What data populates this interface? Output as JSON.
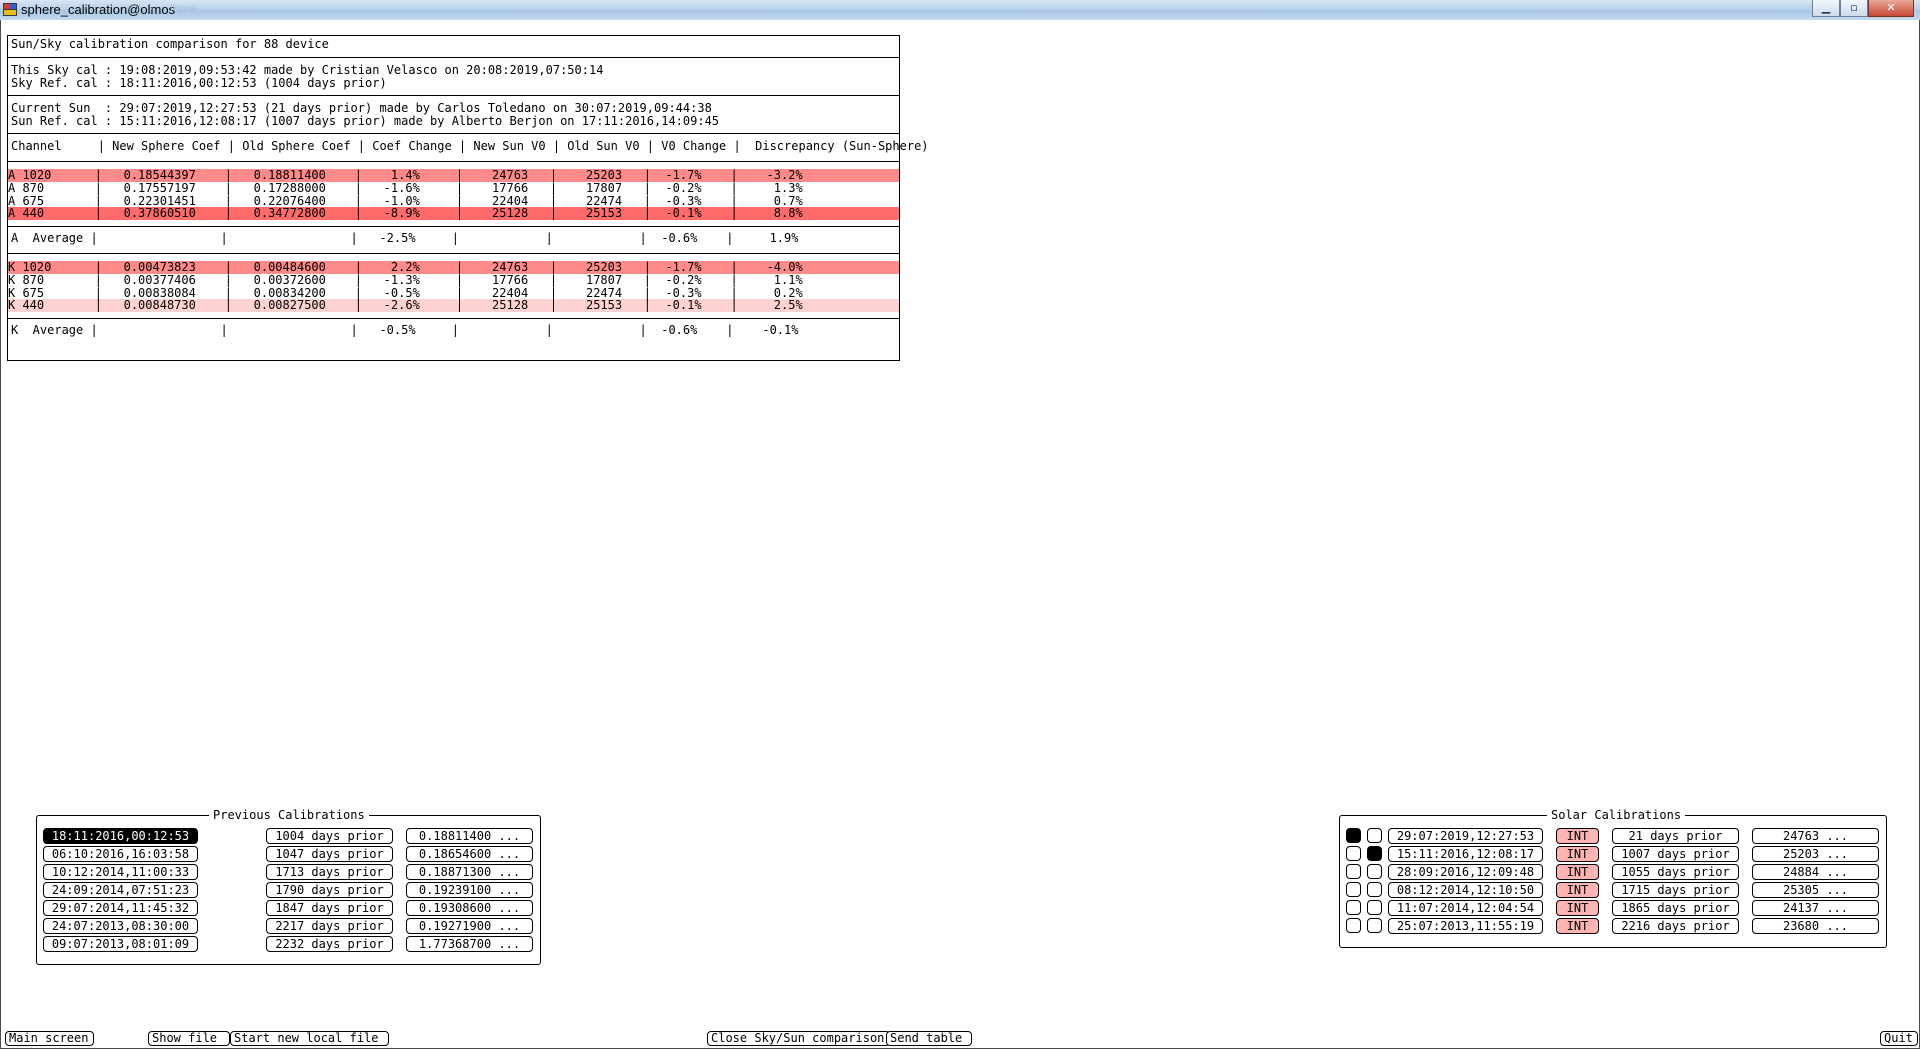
{
  "window": {
    "title": "sphere_calibration@olmos",
    "faded_tail": "· · · Pane"
  },
  "comparison": {
    "header": "Sun/Sky calibration comparison for 88 device",
    "sky_lines": [
      "This Sky cal : 19:08:2019,09:53:42 made by Cristian Velasco on 20:08:2019,07:50:14",
      "Sky Ref. cal : 18:11:2016,00:12:53 (1004 days prior)"
    ],
    "sun_lines": [
      "Current Sun  : 29:07:2019,12:27:53 (21 days prior) made by Carlos Toledano on 30:07:2019,09:44:38",
      "Sun Ref. cal : 15:11:2016,12:08:17 (1007 days prior) made by Alberto Berjon on 17:11:2016,14:09:45"
    ],
    "table_header": "Channel     | New Sphere Coef | Old Sphere Coef | Coef Change | New Sun V0 | Old Sun V0 | V0 Change |  Discrepancy (Sun-Sphere)",
    "a_rows": [
      {
        "text": "A 1020      |   0.18544397    |   0.18811400    |    1.4%     |    24763   |    25203   |  -1.7%    |    -3.2%                     ",
        "hl": "red"
      },
      {
        "text": "A 870       |   0.17557197    |   0.17288000    |   -1.6%     |    17766   |    17807   |  -0.2%    |     1.3%                     ",
        "hl": ""
      },
      {
        "text": "A 675       |   0.22301451    |   0.22076400    |   -1.0%     |    22404   |    22474   |  -0.3%    |     0.7%                     ",
        "hl": ""
      },
      {
        "text": "A 440       |   0.37860510    |   0.34772800    |   -8.9%     |    25128   |    25153   |  -0.1%    |     8.8%                     ",
        "hl": "red2"
      }
    ],
    "a_avg": "A  Average |                 |                 |   -2.5%     |            |            |  -0.6%    |     1.9%",
    "k_rows": [
      {
        "text": "K 1020      |   0.00473823    |   0.00484600    |    2.2%     |    24763   |    25203   |  -1.7%    |    -4.0%                     ",
        "hl": "red"
      },
      {
        "text": "K 870       |   0.00377406    |   0.00372600    |   -1.3%     |    17766   |    17807   |  -0.2%    |     1.1%                     ",
        "hl": ""
      },
      {
        "text": "K 675       |   0.00838084    |   0.00834200    |   -0.5%     |    22404   |    22474   |  -0.3%    |     0.2%                     ",
        "hl": ""
      },
      {
        "text": "K 440       |   0.00848730    |   0.00827500    |   -2.6%     |    25128   |    25153   |  -0.1%    |     2.5%                     ",
        "hl": "pink"
      }
    ],
    "k_avg": "K  Average |                 |                 |   -0.5%     |            |            |  -0.6%    |    -0.1%"
  },
  "previous": {
    "title": "Previous Calibrations",
    "items": [
      {
        "date": "18:11:2016,00:12:53",
        "prior": "1004 days prior",
        "coef": "0.18811400 ...",
        "selected": true
      },
      {
        "date": "06:10:2016,16:03:58",
        "prior": "1047 days prior",
        "coef": "0.18654600 ...",
        "selected": false
      },
      {
        "date": "10:12:2014,11:00:33",
        "prior": "1713 days prior",
        "coef": "0.18871300 ...",
        "selected": false
      },
      {
        "date": "24:09:2014,07:51:23",
        "prior": "1790 days prior",
        "coef": "0.19239100 ...",
        "selected": false
      },
      {
        "date": "29:07:2014,11:45:32",
        "prior": "1847 days prior",
        "coef": "0.19308600 ...",
        "selected": false
      },
      {
        "date": "24:07:2013,08:30:00",
        "prior": "2217 days prior",
        "coef": "0.19271900 ...",
        "selected": false
      },
      {
        "date": "09:07:2013,08:01:09",
        "prior": "2232 days prior",
        "coef": "1.77368700 ...",
        "selected": false
      }
    ]
  },
  "solar": {
    "title": "Solar Calibrations",
    "items": [
      {
        "r1": true,
        "r2": false,
        "date": "29:07:2019,12:27:53",
        "tag": "INT",
        "prior": "21 days prior",
        "v0": "24763 ..."
      },
      {
        "r1": false,
        "r2": true,
        "date": "15:11:2016,12:08:17",
        "tag": "INT",
        "prior": "1007 days prior",
        "v0": "25203 ..."
      },
      {
        "r1": false,
        "r2": false,
        "date": "28:09:2016,12:09:48",
        "tag": "INT",
        "prior": "1055 days prior",
        "v0": "24884 ..."
      },
      {
        "r1": false,
        "r2": false,
        "date": "08:12:2014,12:10:50",
        "tag": "INT",
        "prior": "1715 days prior",
        "v0": "25305 ..."
      },
      {
        "r1": false,
        "r2": false,
        "date": "11:07:2014,12:04:54",
        "tag": "INT",
        "prior": "1865 days prior",
        "v0": "24137 ..."
      },
      {
        "r1": false,
        "r2": false,
        "date": "25:07:2013,11:55:19",
        "tag": "INT",
        "prior": "2216 days prior",
        "v0": "23680 ..."
      }
    ]
  },
  "buttons": {
    "main_screen": "Main screen",
    "show_file": "Show file",
    "start_local": "Start new local file",
    "close_cmp": "Close Sky/Sun comparison",
    "send_table": "Send table",
    "quit": "Quit"
  },
  "colors": {
    "hl_red": "#ff8a8a",
    "hl_red_strong": "#ff6b6b",
    "hl_pink": "#ffd2d2",
    "int_tag": "#ffb4b4"
  }
}
